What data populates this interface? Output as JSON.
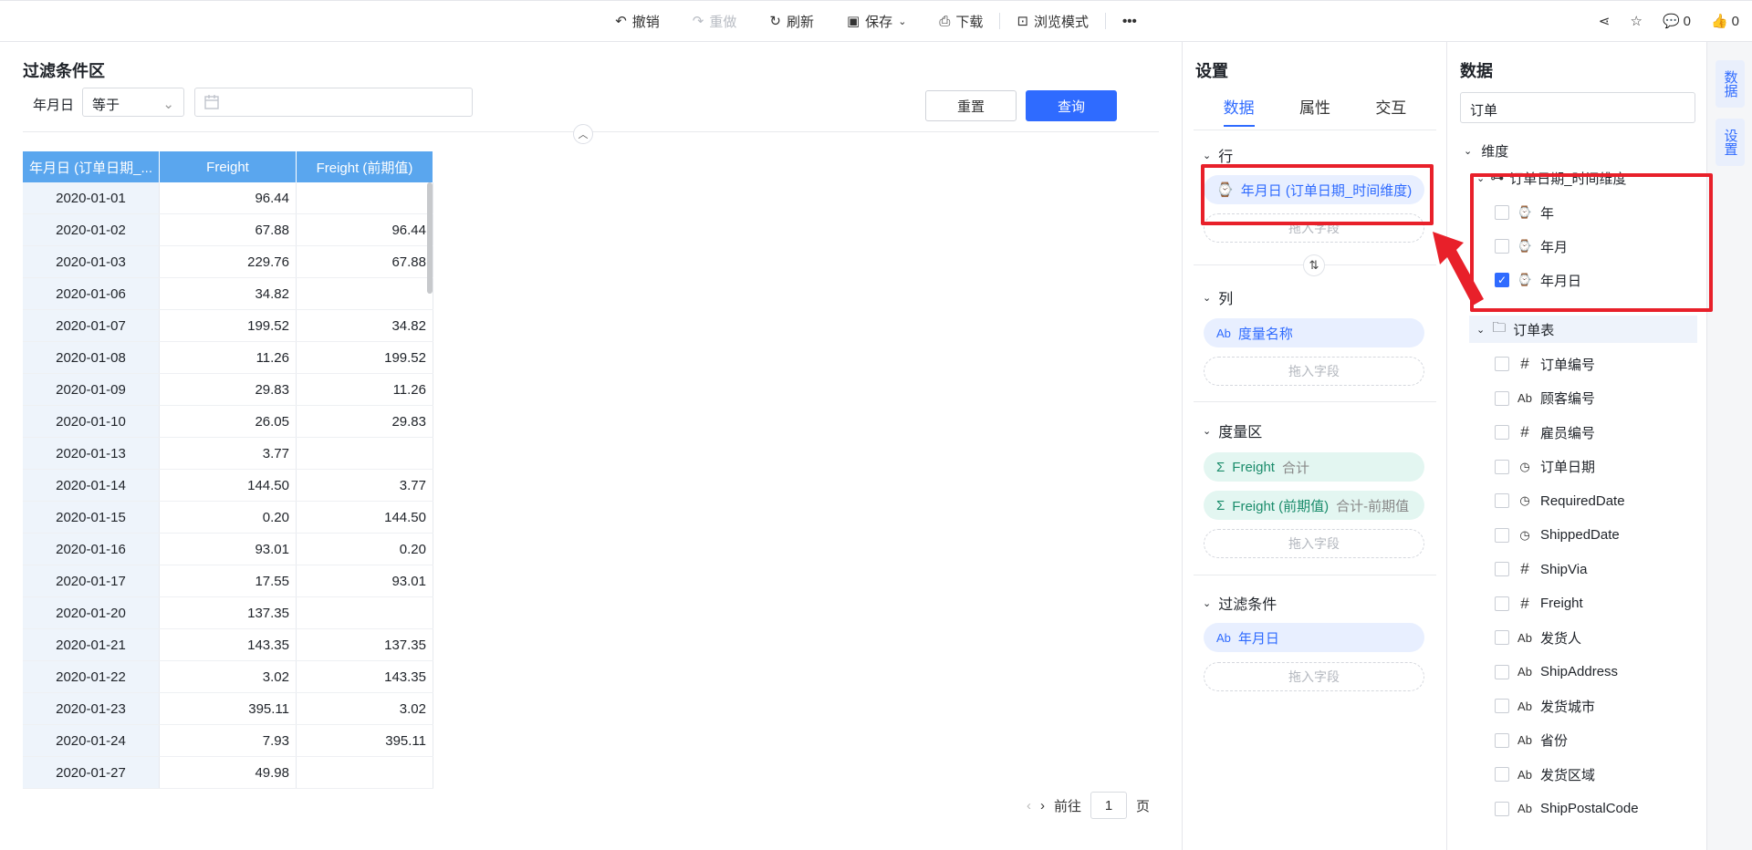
{
  "toolbar": {
    "undo": "撤销",
    "redo": "重做",
    "refresh": "刷新",
    "save": "保存",
    "download": "下载",
    "preview": "浏览模式",
    "comments_count": "0",
    "likes_count": "0"
  },
  "filter": {
    "title": "过滤条件区",
    "field_label": "年月日",
    "operator": "等于",
    "reset": "重置",
    "query": "查询"
  },
  "table": {
    "headers": [
      "年月日 (订单日期_...",
      "Freight",
      "Freight (前期值)"
    ],
    "rows": [
      [
        "2020-01-01",
        "96.44",
        ""
      ],
      [
        "2020-01-02",
        "67.88",
        "96.44"
      ],
      [
        "2020-01-03",
        "229.76",
        "67.88"
      ],
      [
        "2020-01-06",
        "34.82",
        ""
      ],
      [
        "2020-01-07",
        "199.52",
        "34.82"
      ],
      [
        "2020-01-08",
        "11.26",
        "199.52"
      ],
      [
        "2020-01-09",
        "29.83",
        "11.26"
      ],
      [
        "2020-01-10",
        "26.05",
        "29.83"
      ],
      [
        "2020-01-13",
        "3.77",
        ""
      ],
      [
        "2020-01-14",
        "144.50",
        "3.77"
      ],
      [
        "2020-01-15",
        "0.20",
        "144.50"
      ],
      [
        "2020-01-16",
        "93.01",
        "0.20"
      ],
      [
        "2020-01-17",
        "17.55",
        "93.01"
      ],
      [
        "2020-01-20",
        "137.35",
        ""
      ],
      [
        "2020-01-21",
        "143.35",
        "137.35"
      ],
      [
        "2020-01-22",
        "3.02",
        "143.35"
      ],
      [
        "2020-01-23",
        "395.11",
        "3.02"
      ],
      [
        "2020-01-24",
        "7.93",
        "395.11"
      ],
      [
        "2020-01-27",
        "49.98",
        ""
      ]
    ]
  },
  "pager": {
    "goto": "前往",
    "page": "1",
    "unit": "页"
  },
  "settings": {
    "title": "设置",
    "tabs": [
      "数据",
      "属性",
      "交互"
    ],
    "rows_title": "行",
    "rows_field": "年月日 (订单日期_时间维度)",
    "drop_placeholder": "拖入字段",
    "cols_title": "列",
    "cols_field": "度量名称",
    "measure_title": "度量区",
    "measure1_name": "Freight",
    "measure1_sub": "合计",
    "measure2_name": "Freight (前期值)",
    "measure2_sub": "合计-前期值",
    "filter_title": "过滤条件",
    "filter_field": "年月日"
  },
  "data_panel": {
    "title": "数据",
    "search_value": "订单",
    "dimension_title": "维度",
    "hierarchy": "订单日期_时间维度",
    "levels": [
      "年",
      "年月",
      "年月日"
    ],
    "table_name": "订单表",
    "fields": [
      {
        "name": "订单编号",
        "type": "#"
      },
      {
        "name": "顾客编号",
        "type": "Ab"
      },
      {
        "name": "雇员编号",
        "type": "#"
      },
      {
        "name": "订单日期",
        "type": "date"
      },
      {
        "name": "RequiredDate",
        "type": "date"
      },
      {
        "name": "ShippedDate",
        "type": "date"
      },
      {
        "name": "ShipVia",
        "type": "#"
      },
      {
        "name": "Freight",
        "type": "#"
      },
      {
        "name": "发货人",
        "type": "Ab"
      },
      {
        "name": "ShipAddress",
        "type": "Ab"
      },
      {
        "name": "发货城市",
        "type": "Ab"
      },
      {
        "name": "省份",
        "type": "Ab"
      },
      {
        "name": "发货区域",
        "type": "Ab"
      },
      {
        "name": "ShipPostalCode",
        "type": "Ab"
      }
    ]
  },
  "side_tabs": [
    "数据",
    "设置"
  ]
}
